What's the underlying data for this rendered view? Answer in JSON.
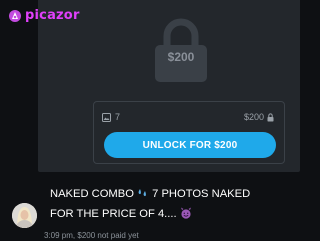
{
  "watermark": {
    "brand": "picazor",
    "logo_icon": "unicorn-icon"
  },
  "locked_post": {
    "price_badge": "$200",
    "photo_count": "7",
    "box_price": "$200",
    "unlock_button_label": "UNLOCK FOR $200"
  },
  "message": {
    "line1": "NAKED COMBO",
    "line1_emoji": "sweat-droplets-emoji",
    "line1_rest": "7 PHOTOS NAKED",
    "line2": "FOR THE PRICE OF 4....",
    "line2_emoji": "smiling-devil-emoji"
  },
  "meta": {
    "time": "3:09 pm,",
    "price_status": "$200 not paid yet"
  },
  "colors": {
    "accent": "#1fa9ea",
    "brand": "#e040fb",
    "card_bg": "#23272c",
    "page_bg": "#0e1013"
  }
}
